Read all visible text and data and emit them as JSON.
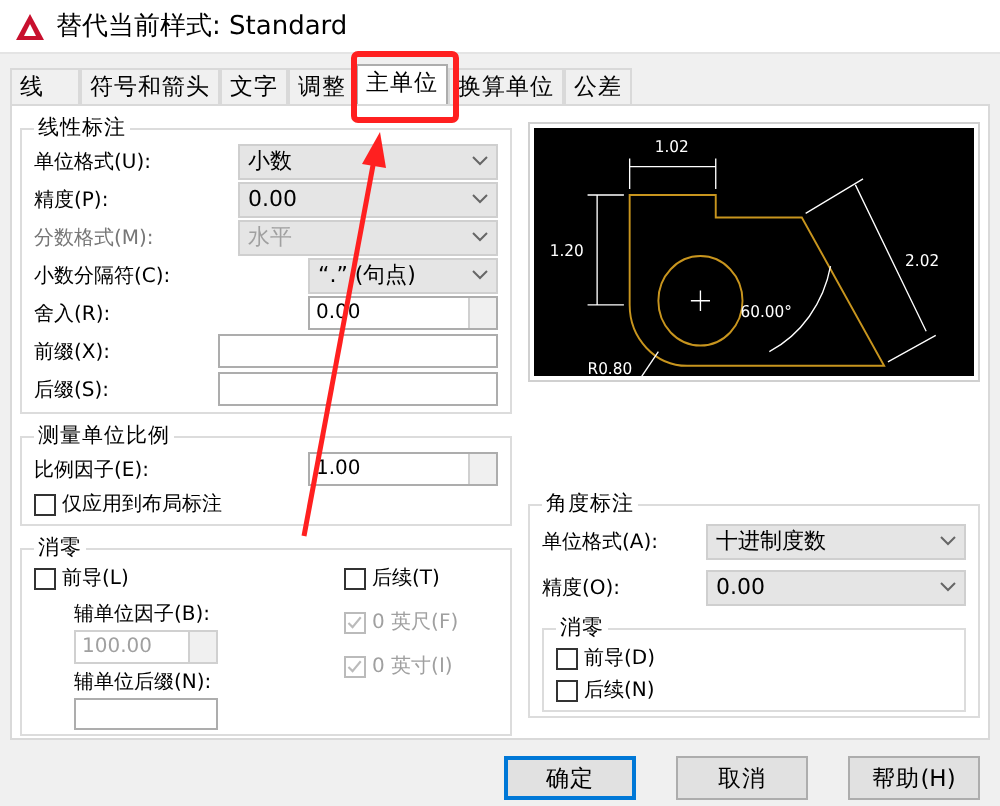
{
  "window": {
    "title": "替代当前样式: Standard"
  },
  "tabs": [
    {
      "label": "线",
      "selected": false
    },
    {
      "label": "符号和箭头",
      "selected": false
    },
    {
      "label": "文字",
      "selected": false
    },
    {
      "label": "调整",
      "selected": false
    },
    {
      "label": "主单位",
      "selected": true
    },
    {
      "label": "换算单位",
      "selected": false
    },
    {
      "label": "公差",
      "selected": false
    }
  ],
  "linear": {
    "title": "线性标注",
    "fields": [
      {
        "label": "单位格式(U):",
        "kind": "select",
        "value": "小数",
        "disabled": false
      },
      {
        "label": "精度(P):",
        "kind": "select",
        "value": "0.00",
        "disabled": false
      },
      {
        "label": "分数格式(M):",
        "kind": "select",
        "value": "水平",
        "disabled": true
      },
      {
        "label": "小数分隔符(C):",
        "kind": "select-short",
        "value": "“.” (句点)",
        "disabled": false
      },
      {
        "label": "舍入(R):",
        "kind": "spinner",
        "value": "0.00",
        "disabled": false
      },
      {
        "label": "前缀(X):",
        "kind": "text",
        "disabled": false
      },
      {
        "label": "后缀(S):",
        "kind": "text",
        "disabled": false
      }
    ]
  },
  "scale": {
    "title": "测量单位比例",
    "factor_label": "比例因子(E):",
    "factor": "1.00",
    "layout_only": {
      "label": "仅应用到布局标注",
      "checked": false
    }
  },
  "zero": {
    "title": "消零",
    "leading": {
      "label": "前导(L)",
      "checked": false
    },
    "sub_factor_label": "辅单位因子(B):",
    "sub_factor": "100.00",
    "sub_suffix_label": "辅单位后缀(N):",
    "trailing": {
      "label": "后续(T)",
      "checked": false
    },
    "feet": {
      "label": "0 英尺(F)",
      "checked": true,
      "disabled": true
    },
    "inches": {
      "label": "0 英寸(I)",
      "checked": true,
      "disabled": true
    }
  },
  "preview": {
    "labels": [
      "1.02",
      "1.20",
      "2.02",
      "60.00°",
      "R0.80"
    ]
  },
  "angular": {
    "title": "角度标注",
    "fields": [
      {
        "label": "单位格式(A):",
        "kind": "select",
        "value": "十进制度数",
        "disabled": false
      },
      {
        "label": "精度(O):",
        "kind": "select",
        "value": "0.00",
        "disabled": false
      }
    ],
    "zero": {
      "title": "消零",
      "options": [
        {
          "label": "前导(D)",
          "checked": false
        },
        {
          "label": "后续(N)",
          "checked": false
        }
      ]
    }
  },
  "buttons": [
    {
      "label": "确定",
      "default": true
    },
    {
      "label": "取消",
      "default": false
    },
    {
      "label": "帮助(H)",
      "default": false
    }
  ]
}
